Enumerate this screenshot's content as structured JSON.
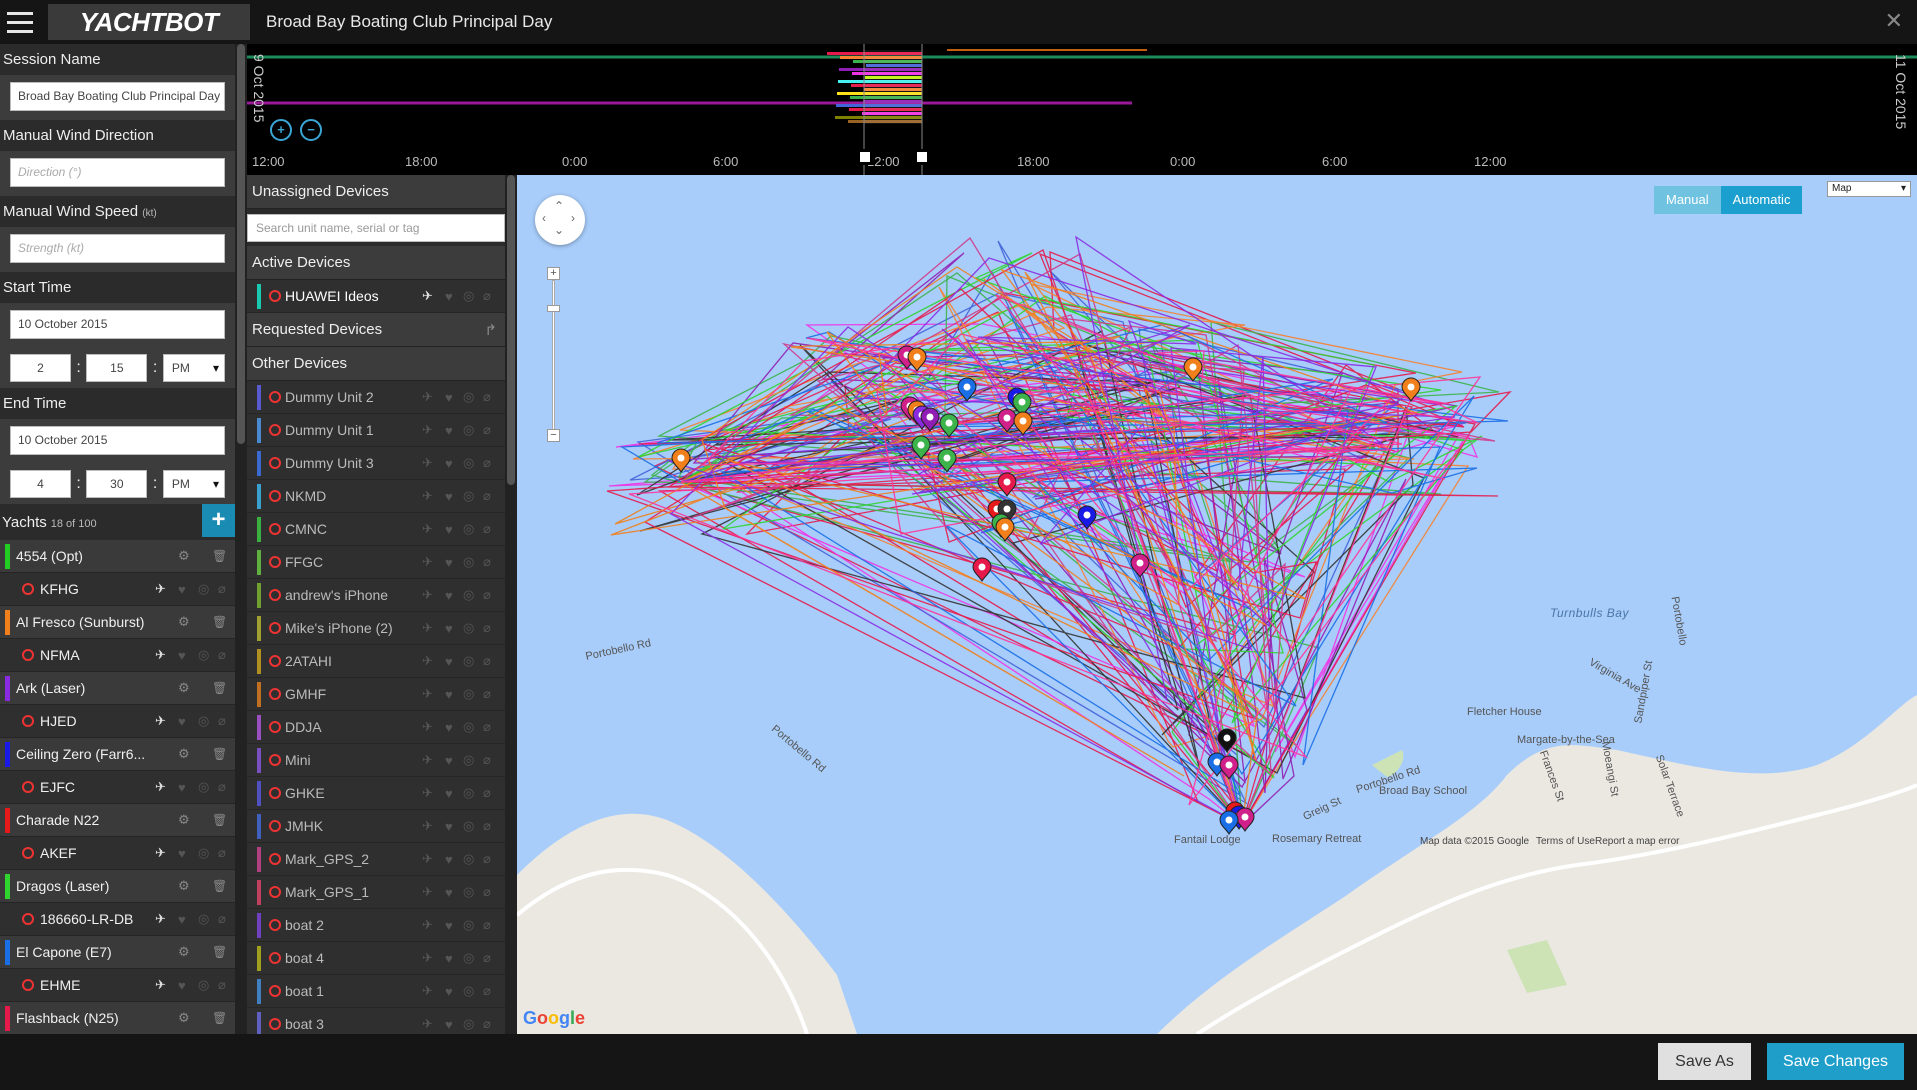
{
  "app": {
    "logo": "YACHTBOT",
    "title": "Broad Bay Boating Club Principal Day",
    "close_glyph": "✕"
  },
  "sidebar": {
    "session_name_label": "Session Name",
    "session_name_value": "Broad Bay Boating Club Principal Day",
    "wind_dir_label": "Manual Wind Direction",
    "wind_dir_placeholder": "Direction (°)",
    "wind_speed_label": "Manual Wind Speed",
    "wind_speed_unit": "(kt)",
    "wind_speed_placeholder": "Strength (kt)",
    "start_label": "Start Time",
    "start_date": "10 October 2015",
    "start_hour": "2",
    "start_min": "15",
    "start_ampm": "PM",
    "end_label": "End Time",
    "end_date": "10 October 2015",
    "end_hour": "4",
    "end_min": "30",
    "end_ampm": "PM",
    "time_sep": ":",
    "yachts_label": "Yachts",
    "yachts_count": "18 of 100",
    "add_glyph": "+"
  },
  "yachts": [
    {
      "name": "4554 (Opt)",
      "color": "#22cc22",
      "device": "KFHG"
    },
    {
      "name": "Al Fresco (Sunburst)",
      "color": "#f07f1c",
      "device": "NFMA"
    },
    {
      "name": "Ark (Laser)",
      "color": "#8a2be2",
      "device": "HJED"
    },
    {
      "name": "Ceiling Zero (Farr6...",
      "color": "#1a1ae6",
      "device": "EJFC"
    },
    {
      "name": "Charade N22",
      "color": "#e61a1a",
      "device": "AKEF"
    },
    {
      "name": "Dragos (Laser)",
      "color": "#2fd42f",
      "device": "186660-LR-DB"
    },
    {
      "name": "El Capone (E7)",
      "color": "#1a6fe6",
      "device": "EHME"
    },
    {
      "name": "Flashback (N25)",
      "color": "#e6194b",
      "device": ""
    }
  ],
  "timeline": {
    "date_left": "9 Oct 2015",
    "date_right": "11 Oct 2015",
    "ticks": [
      "12:00",
      "18:00",
      "0:00",
      "6:00",
      "12:00",
      "18:00",
      "0:00",
      "6:00",
      "12:00"
    ],
    "zoom_in": "+",
    "zoom_out": "−"
  },
  "devices": {
    "unassigned_label": "Unassigned Devices",
    "search_placeholder": "Search unit name, serial or tag",
    "active_label": "Active Devices",
    "active": [
      {
        "name": "HUAWEI Ideos",
        "color": "#19c9b0"
      }
    ],
    "requested_label": "Requested Devices",
    "requested_glyph": "↱",
    "other_label": "Other Devices",
    "other": [
      {
        "name": "Dummy Unit 2",
        "color": "#5a5ad0"
      },
      {
        "name": "Dummy Unit 1",
        "color": "#4a8ad0"
      },
      {
        "name": "Dummy Unit 3",
        "color": "#3a6ad0"
      },
      {
        "name": "NKMD",
        "color": "#3aa0d0"
      },
      {
        "name": "CMNC",
        "color": "#3ab040"
      },
      {
        "name": "FFGC",
        "color": "#60b040"
      },
      {
        "name": "andrew's iPhone",
        "color": "#70a030"
      },
      {
        "name": "Mike's iPhone (2)",
        "color": "#a0a030"
      },
      {
        "name": "2ATAHI",
        "color": "#b09020"
      },
      {
        "name": "GMHF",
        "color": "#c07020"
      },
      {
        "name": "DDJA",
        "color": "#9a50c0"
      },
      {
        "name": "Mini",
        "color": "#7a50c0"
      },
      {
        "name": "GHKE",
        "color": "#5050c0"
      },
      {
        "name": "JMHK",
        "color": "#4060c0"
      },
      {
        "name": "Mark_GPS_2",
        "color": "#b04080"
      },
      {
        "name": "Mark_GPS_1",
        "color": "#c04060"
      },
      {
        "name": "boat 2",
        "color": "#7040c0"
      },
      {
        "name": "boat 4",
        "color": "#a0a020"
      },
      {
        "name": "boat 1",
        "color": "#4080c0"
      },
      {
        "name": "boat 3",
        "color": "#6060c0"
      }
    ]
  },
  "map": {
    "mode_manual": "Manual",
    "mode_auto": "Automatic",
    "type": "Map",
    "zoom_plus": "+",
    "zoom_minus": "−",
    "pan_up": "⌃",
    "pan_down": "⌄",
    "pan_left": "‹",
    "pan_right": "›",
    "google_letters": [
      {
        "ch": "G",
        "color": "#4285f4"
      },
      {
        "ch": "o",
        "color": "#ea4335"
      },
      {
        "ch": "o",
        "color": "#fbbc05"
      },
      {
        "ch": "g",
        "color": "#4285f4"
      },
      {
        "ch": "l",
        "color": "#34a853"
      },
      {
        "ch": "e",
        "color": "#ea4335"
      }
    ],
    "labels": [
      {
        "name": "portobello-rd-1",
        "text": "Portobello Rd",
        "water": false
      },
      {
        "name": "portobello-rd-2",
        "text": "Portobello Rd",
        "water": false
      },
      {
        "name": "portobello-rd-3",
        "text": "Portobello Rd",
        "water": false
      },
      {
        "name": "turnbulls-bay",
        "text": "Turnbulls Bay",
        "water": true
      },
      {
        "name": "virginia-ave",
        "text": "Virginia Ave",
        "water": false
      },
      {
        "name": "sandpiper-st",
        "text": "Sandpiper St",
        "water": false
      },
      {
        "name": "fletcher-house",
        "text": "Fletcher House",
        "water": false
      },
      {
        "name": "margate",
        "text": "Margate-by-the-Sea",
        "water": false
      },
      {
        "name": "broad-bay-school",
        "text": "Broad Bay School",
        "water": false
      },
      {
        "name": "frances-st",
        "text": "Frances St",
        "water": false
      },
      {
        "name": "moeangi-st",
        "text": "Moeangi St",
        "water": false
      },
      {
        "name": "solar-terrace",
        "text": "Solar Terrace",
        "water": false
      },
      {
        "name": "greig-st",
        "text": "Greig St",
        "water": false
      },
      {
        "name": "fantail-lodge",
        "text": "Fantail Lodge",
        "water": false
      },
      {
        "name": "rosemary-retreat",
        "text": "Rosemary Retreat",
        "water": false
      },
      {
        "name": "portobello-edge",
        "text": "Portobello",
        "water": false
      }
    ],
    "attrib": [
      "Map data ©2015 Google",
      "Terms of Use",
      "Report a map error"
    ]
  },
  "footer": {
    "save_as": "Save As",
    "save_changes": "Save Changes"
  },
  "colors": {
    "accent": "#1f9ec9",
    "mode_manual": "#6fc3e0",
    "mode_auto": "#1a9fcf",
    "water": "#a8cdfa",
    "land": "#ebe8e2"
  }
}
